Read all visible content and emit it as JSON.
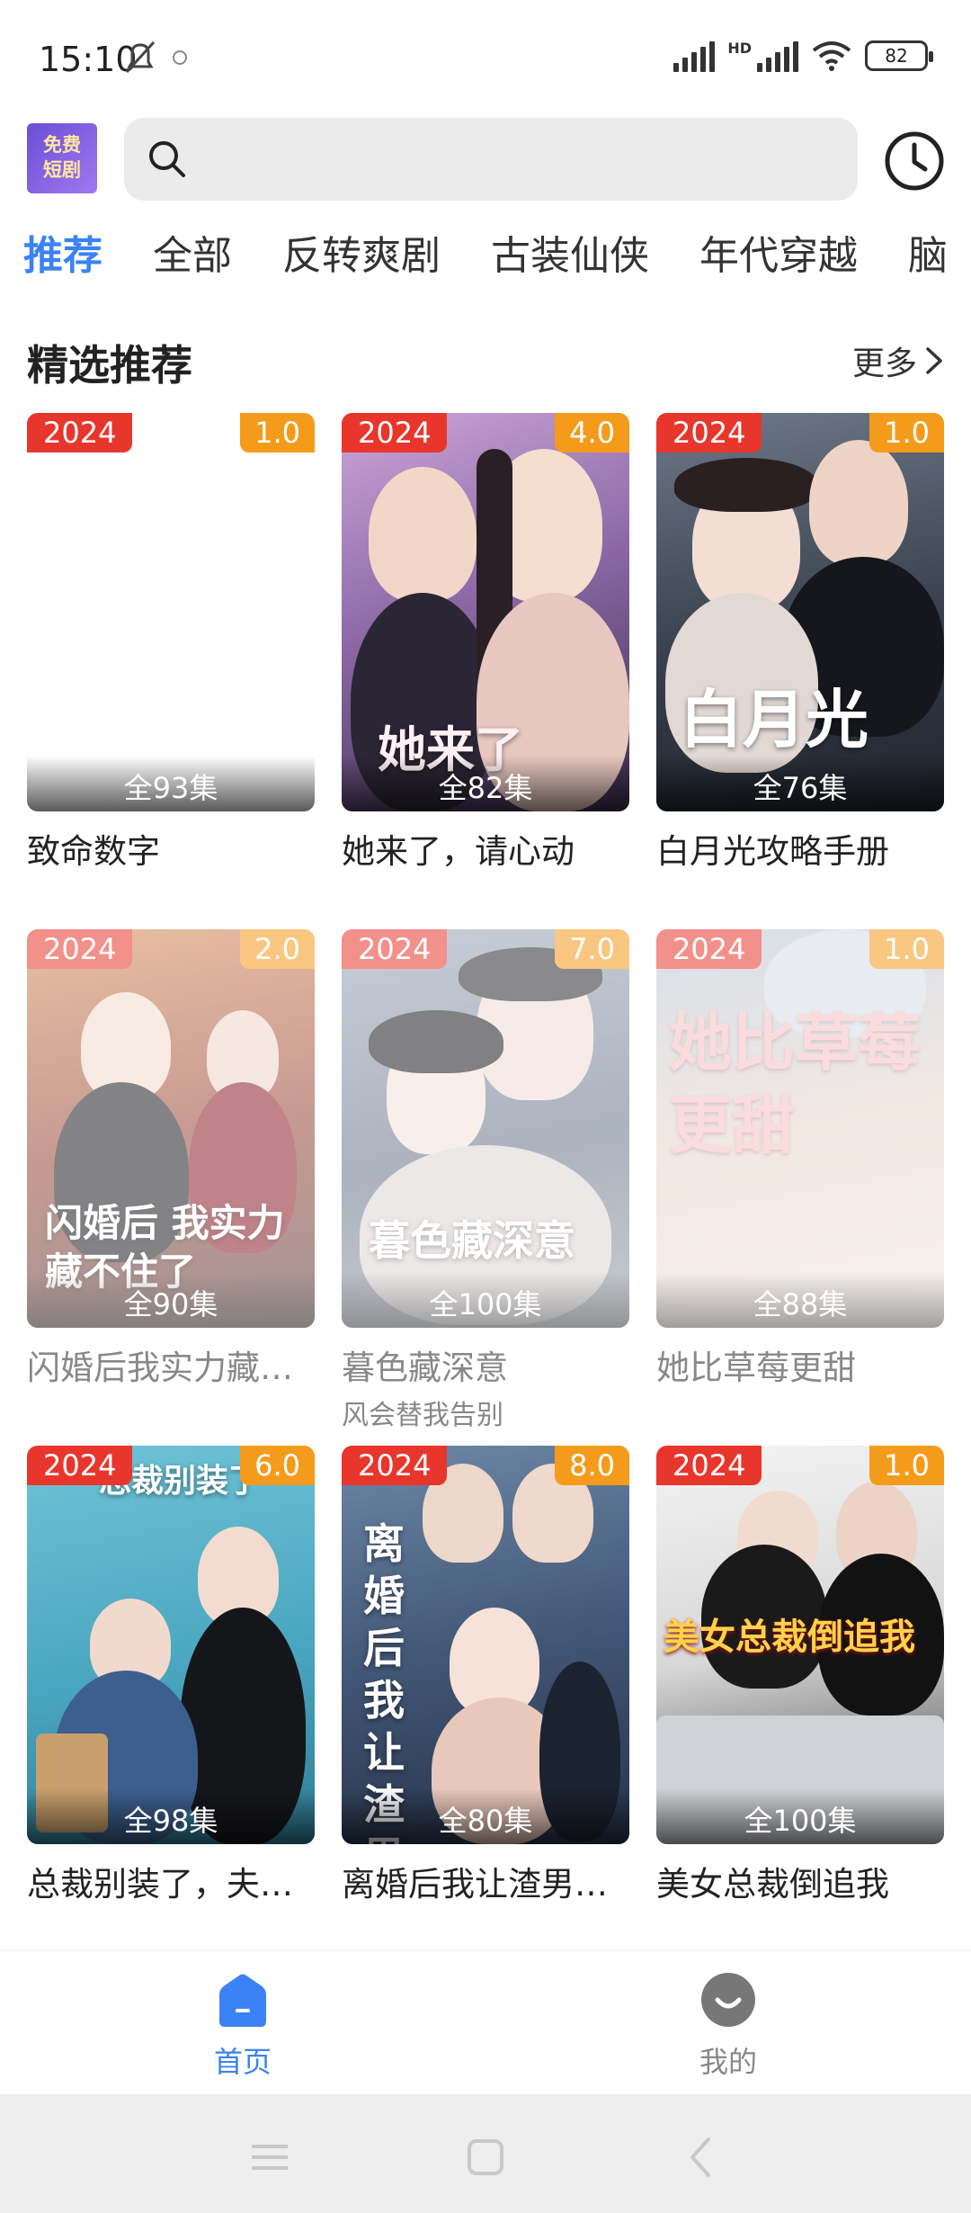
{
  "status": {
    "time": "15:10",
    "hd": "HD",
    "battery": "82"
  },
  "header": {
    "logo_line1": "免费",
    "logo_line2": "短剧",
    "search_placeholder": ""
  },
  "tabs": [
    "推荐",
    "全部",
    "反转爽剧",
    "古装仙侠",
    "年代穿越",
    "脑"
  ],
  "section": {
    "title": "精选推荐",
    "more": "更多"
  },
  "cards": [
    {
      "year": "2024",
      "score": "1.0",
      "episodes": "全93集",
      "title": "致命数字",
      "subtitle": "",
      "poster_text": ""
    },
    {
      "year": "2024",
      "score": "4.0",
      "episodes": "全82集",
      "title": "她来了，请心动",
      "subtitle": "",
      "poster_text": "她来了"
    },
    {
      "year": "2024",
      "score": "1.0",
      "episodes": "全76集",
      "title": "白月光攻略手册",
      "subtitle": "",
      "poster_text": "白月光"
    },
    {
      "year": "2024",
      "score": "2.0",
      "episodes": "全90集",
      "title": "闪婚后我实力藏不住了",
      "subtitle": "",
      "poster_text": "闪婚后 我实力藏不住了"
    },
    {
      "year": "2024",
      "score": "7.0",
      "episodes": "全100集",
      "title": "暮色藏深意",
      "subtitle": "风会替我告别",
      "poster_text": "暮色藏深意"
    },
    {
      "year": "2024",
      "score": "1.0",
      "episodes": "全88集",
      "title": "她比草莓更甜",
      "subtitle": "",
      "poster_text": "她比草莓 更甜"
    },
    {
      "year": "2024",
      "score": "6.0",
      "episodes": "全98集",
      "title": "总裁别装了，夫人知道你是千亿大佬了",
      "subtitle": "",
      "poster_text": "总裁别装了"
    },
    {
      "year": "2024",
      "score": "8.0",
      "episodes": "全80集",
      "title": "离婚后我让渣男倾家荡产",
      "subtitle": "",
      "poster_text": "离婚后我让渣男倾家"
    },
    {
      "year": "2024",
      "score": "1.0",
      "episodes": "全100集",
      "title": "美女总裁倒追我",
      "subtitle": "",
      "poster_text": "美女总裁倒追我"
    }
  ],
  "nav": {
    "home": "首页",
    "mine": "我的"
  },
  "colors": {
    "accent": "#3b82f6",
    "year_badge": "#e8362c",
    "score_badge": "#f59b1c"
  }
}
